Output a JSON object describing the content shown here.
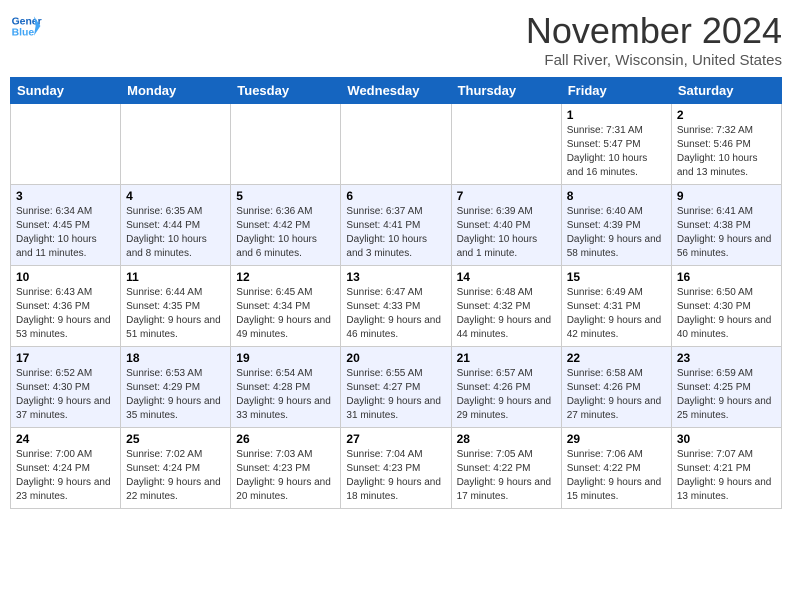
{
  "header": {
    "logo_line1": "General",
    "logo_line2": "Blue",
    "month": "November 2024",
    "location": "Fall River, Wisconsin, United States"
  },
  "weekdays": [
    "Sunday",
    "Monday",
    "Tuesday",
    "Wednesday",
    "Thursday",
    "Friday",
    "Saturday"
  ],
  "weeks": [
    [
      {
        "day": "",
        "info": ""
      },
      {
        "day": "",
        "info": ""
      },
      {
        "day": "",
        "info": ""
      },
      {
        "day": "",
        "info": ""
      },
      {
        "day": "",
        "info": ""
      },
      {
        "day": "1",
        "info": "Sunrise: 7:31 AM\nSunset: 5:47 PM\nDaylight: 10 hours and 16 minutes."
      },
      {
        "day": "2",
        "info": "Sunrise: 7:32 AM\nSunset: 5:46 PM\nDaylight: 10 hours and 13 minutes."
      }
    ],
    [
      {
        "day": "3",
        "info": "Sunrise: 6:34 AM\nSunset: 4:45 PM\nDaylight: 10 hours and 11 minutes."
      },
      {
        "day": "4",
        "info": "Sunrise: 6:35 AM\nSunset: 4:44 PM\nDaylight: 10 hours and 8 minutes."
      },
      {
        "day": "5",
        "info": "Sunrise: 6:36 AM\nSunset: 4:42 PM\nDaylight: 10 hours and 6 minutes."
      },
      {
        "day": "6",
        "info": "Sunrise: 6:37 AM\nSunset: 4:41 PM\nDaylight: 10 hours and 3 minutes."
      },
      {
        "day": "7",
        "info": "Sunrise: 6:39 AM\nSunset: 4:40 PM\nDaylight: 10 hours and 1 minute."
      },
      {
        "day": "8",
        "info": "Sunrise: 6:40 AM\nSunset: 4:39 PM\nDaylight: 9 hours and 58 minutes."
      },
      {
        "day": "9",
        "info": "Sunrise: 6:41 AM\nSunset: 4:38 PM\nDaylight: 9 hours and 56 minutes."
      }
    ],
    [
      {
        "day": "10",
        "info": "Sunrise: 6:43 AM\nSunset: 4:36 PM\nDaylight: 9 hours and 53 minutes."
      },
      {
        "day": "11",
        "info": "Sunrise: 6:44 AM\nSunset: 4:35 PM\nDaylight: 9 hours and 51 minutes."
      },
      {
        "day": "12",
        "info": "Sunrise: 6:45 AM\nSunset: 4:34 PM\nDaylight: 9 hours and 49 minutes."
      },
      {
        "day": "13",
        "info": "Sunrise: 6:47 AM\nSunset: 4:33 PM\nDaylight: 9 hours and 46 minutes."
      },
      {
        "day": "14",
        "info": "Sunrise: 6:48 AM\nSunset: 4:32 PM\nDaylight: 9 hours and 44 minutes."
      },
      {
        "day": "15",
        "info": "Sunrise: 6:49 AM\nSunset: 4:31 PM\nDaylight: 9 hours and 42 minutes."
      },
      {
        "day": "16",
        "info": "Sunrise: 6:50 AM\nSunset: 4:30 PM\nDaylight: 9 hours and 40 minutes."
      }
    ],
    [
      {
        "day": "17",
        "info": "Sunrise: 6:52 AM\nSunset: 4:30 PM\nDaylight: 9 hours and 37 minutes."
      },
      {
        "day": "18",
        "info": "Sunrise: 6:53 AM\nSunset: 4:29 PM\nDaylight: 9 hours and 35 minutes."
      },
      {
        "day": "19",
        "info": "Sunrise: 6:54 AM\nSunset: 4:28 PM\nDaylight: 9 hours and 33 minutes."
      },
      {
        "day": "20",
        "info": "Sunrise: 6:55 AM\nSunset: 4:27 PM\nDaylight: 9 hours and 31 minutes."
      },
      {
        "day": "21",
        "info": "Sunrise: 6:57 AM\nSunset: 4:26 PM\nDaylight: 9 hours and 29 minutes."
      },
      {
        "day": "22",
        "info": "Sunrise: 6:58 AM\nSunset: 4:26 PM\nDaylight: 9 hours and 27 minutes."
      },
      {
        "day": "23",
        "info": "Sunrise: 6:59 AM\nSunset: 4:25 PM\nDaylight: 9 hours and 25 minutes."
      }
    ],
    [
      {
        "day": "24",
        "info": "Sunrise: 7:00 AM\nSunset: 4:24 PM\nDaylight: 9 hours and 23 minutes."
      },
      {
        "day": "25",
        "info": "Sunrise: 7:02 AM\nSunset: 4:24 PM\nDaylight: 9 hours and 22 minutes."
      },
      {
        "day": "26",
        "info": "Sunrise: 7:03 AM\nSunset: 4:23 PM\nDaylight: 9 hours and 20 minutes."
      },
      {
        "day": "27",
        "info": "Sunrise: 7:04 AM\nSunset: 4:23 PM\nDaylight: 9 hours and 18 minutes."
      },
      {
        "day": "28",
        "info": "Sunrise: 7:05 AM\nSunset: 4:22 PM\nDaylight: 9 hours and 17 minutes."
      },
      {
        "day": "29",
        "info": "Sunrise: 7:06 AM\nSunset: 4:22 PM\nDaylight: 9 hours and 15 minutes."
      },
      {
        "day": "30",
        "info": "Sunrise: 7:07 AM\nSunset: 4:21 PM\nDaylight: 9 hours and 13 minutes."
      }
    ]
  ]
}
